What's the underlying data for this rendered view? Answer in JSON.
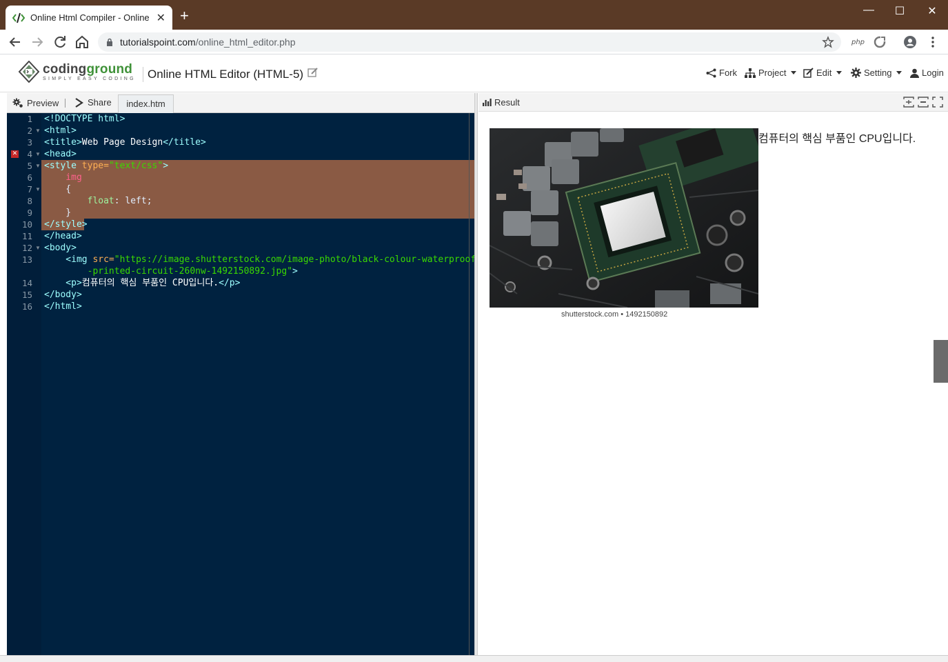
{
  "browser": {
    "tab_title": "Online Html Compiler - Online H",
    "url_host": "tutorialspoint.com",
    "url_path": "/online_html_editor.php",
    "window_controls": [
      "—",
      "☐",
      "✕"
    ]
  },
  "header": {
    "brand_name_a": "coding",
    "brand_name_b": "ground",
    "brand_tagline": "SIMPLY EASY CODING",
    "page_title": "Online HTML Editor (HTML-5)",
    "menu": {
      "fork": "Fork",
      "project": "Project",
      "edit": "Edit",
      "setting": "Setting",
      "login": "Login"
    }
  },
  "left": {
    "preview": "Preview",
    "share": "Share",
    "file_tab": "index.htm",
    "line_numbers": [
      "1",
      "2",
      "3",
      "4",
      "5",
      "6",
      "7",
      "8",
      "9",
      "10",
      "11",
      "12",
      "13",
      "",
      "14",
      "15",
      "16"
    ]
  },
  "code": {
    "l1": "<!DOCTYPE html>",
    "l2": "<html>",
    "l3_open": "<title>",
    "l3_text": "Web Page Design",
    "l3_close": "</title>",
    "l4": "<head>",
    "l5_tag": "<style",
    "l5_attr": " type=",
    "l5_str": "\"text/css\"",
    "l5_end": ">",
    "l6": "    img",
    "l7": "    {",
    "l8_prop": "        float",
    "l8_rest": ": left;",
    "l9": "    }",
    "l10": "</style>",
    "l11": "</head>",
    "l12": "<body>",
    "l13_tag": "    <img",
    "l13_attr": " src=",
    "l13_str": "\"https://image.shutterstock.com/image-photo/black-colour-waterproof",
    "l13b_str": "        -printed-circuit-260nw-1492150892.jpg\"",
    "l13b_end": ">",
    "l14_open": "    <p>",
    "l14_text": "컴퓨터의 핵심 부품인 CPU입니다.",
    "l14_close": "</p>",
    "l15": "</body>",
    "l16": "</html>"
  },
  "result": {
    "label": "Result",
    "image_caption": "shutterstock.com • 1492150892",
    "paragraph": "컴퓨터의 핵심 부품인 CPU입니다."
  }
}
